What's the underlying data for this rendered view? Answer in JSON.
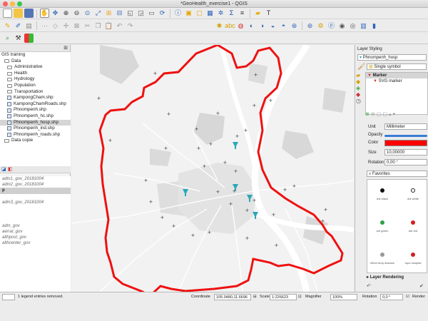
{
  "window": {
    "title": "*GeoHealth_exercise1 - QGIS"
  },
  "browser_panel": {
    "root": "GIS training",
    "items": [
      {
        "label": "Data",
        "type": "folder",
        "indent": 1
      },
      {
        "label": "Administrative",
        "type": "folder",
        "indent": 2
      },
      {
        "label": "Health",
        "type": "folder",
        "indent": 2
      },
      {
        "label": "Hydrology",
        "type": "folder",
        "indent": 2
      },
      {
        "label": "Population",
        "type": "folder",
        "indent": 2
      },
      {
        "label": "Transportation",
        "type": "folder",
        "indent": 2
      },
      {
        "label": "KampongCham.shp",
        "type": "shp",
        "indent": 2
      },
      {
        "label": "KampongChamRoads.shp",
        "type": "shp",
        "indent": 2
      },
      {
        "label": "Phnompenh.shp",
        "type": "shp",
        "indent": 2
      },
      {
        "label": "Phnompenh_hc.shp",
        "type": "shp",
        "indent": 2
      },
      {
        "label": "Phnompenh_hosp.shp",
        "type": "shp",
        "indent": 2,
        "selected": true
      },
      {
        "label": "Phnompenh_ind.shp",
        "type": "shp",
        "indent": 2
      },
      {
        "label": "Phnompenh_roads.shp",
        "type": "shp",
        "indent": 2
      },
      {
        "label": "Data copie",
        "type": "folder",
        "indent": 1
      }
    ]
  },
  "layers_panel": {
    "items": [
      {
        "label": "adm1_gov_20181004",
        "style": "italic"
      },
      {
        "label": "adm2_gov_20181004",
        "style": "italic"
      },
      {
        "label": "p",
        "style": "bold"
      },
      {
        "label": "",
        "style": "italic"
      },
      {
        "label": "adm3_gov_20181004",
        "style": "italic"
      },
      {
        "label": "",
        "style": "italic"
      },
      {
        "label": "",
        "style": "italic"
      },
      {
        "label": "",
        "style": "italic"
      },
      {
        "label": "adm_gov",
        "style": "italic"
      },
      {
        "label": "aerral_gov",
        "style": "italic"
      },
      {
        "label": "althpost_gov",
        "style": "italic"
      },
      {
        "label": "althcenter_gov",
        "style": "italic"
      }
    ]
  },
  "styling_panel": {
    "title": "Layer Styling",
    "layer": "Phnompenh_hosp",
    "renderer": "Single symbol",
    "marker": "Marker",
    "svg_marker": "SVG marker",
    "unit_label": "Unit",
    "unit_value": "Millimeter",
    "opacity_label": "Opacity",
    "color_label": "Color",
    "color_value": "#ff0000",
    "size_label": "Size",
    "size_value": "10,00000",
    "rotation_label": "Rotation",
    "rotation_value": "0,00 °",
    "favorites_label": "Favorites",
    "symbols": [
      {
        "name": "dot  black",
        "color": "#111111",
        "outline": false
      },
      {
        "name": "dot  white",
        "color": "#ffffff",
        "outline": true
      },
      {
        "name": "dot green",
        "color": "#2ea043",
        "outline": false
      },
      {
        "name": "dot red",
        "color": "#d62020",
        "outline": false
      },
      {
        "name": "effect drop shadow",
        "color": "#999999",
        "outline": false
      },
      {
        "name": "topo hospital",
        "color": "#cc2222",
        "outline": false
      }
    ],
    "layer_rendering": "Layer Rendering"
  },
  "status_bar": {
    "message": "1 legend entries removed.",
    "coordinate_label": "Coordinate",
    "coordinate_value": "105.0480,11.6696",
    "scale_label": "Scale",
    "scale_value": "1:226623",
    "magnifier_label": "Magnifier",
    "magnifier_value": "100%",
    "rotation_label": "Rotation",
    "rotation_value": "0,0 °",
    "render_label": "Render"
  },
  "map": {
    "boundary_color": "#ee1111",
    "hospital_color": "#2aa8b8"
  }
}
